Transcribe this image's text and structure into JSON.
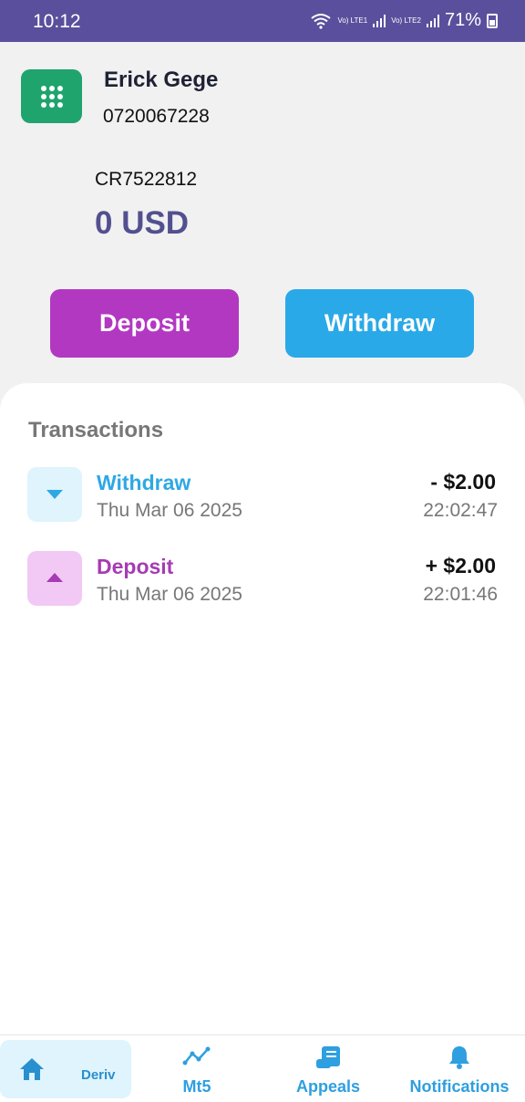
{
  "status_bar": {
    "time": "10:12",
    "network1": "Vo) LTE1",
    "network2": "Vo) LTE2",
    "battery": "71%"
  },
  "profile": {
    "name": "Erick Gege",
    "phone": "0720067228",
    "account_id": "CR7522812",
    "balance": "0 USD"
  },
  "actions": {
    "deposit_label": "Deposit",
    "withdraw_label": "Withdraw"
  },
  "transactions": {
    "heading": "Transactions",
    "items": [
      {
        "type": "Withdraw",
        "date": "Thu Mar 06 2025",
        "amount": "- $2.00",
        "time": "22:02:47",
        "icon": "arrow-down-icon"
      },
      {
        "type": "Deposit",
        "date": "Thu Mar 06 2025",
        "amount": "+ $2.00",
        "time": "22:01:46",
        "icon": "arrow-up-icon"
      }
    ]
  },
  "nav": {
    "items": [
      {
        "label": "Deriv",
        "icon": "home-icon"
      },
      {
        "label": "Mt5",
        "icon": "chart-line-icon"
      },
      {
        "label": "Appeals",
        "icon": "scroll-icon"
      },
      {
        "label": "Notifications",
        "icon": "bell-icon"
      }
    ]
  },
  "colors": {
    "status_bar": "#5a4f9c",
    "deposit": "#b238c2",
    "withdraw": "#2aa9e8",
    "logo": "#1fa46e",
    "balance": "#53508f"
  }
}
